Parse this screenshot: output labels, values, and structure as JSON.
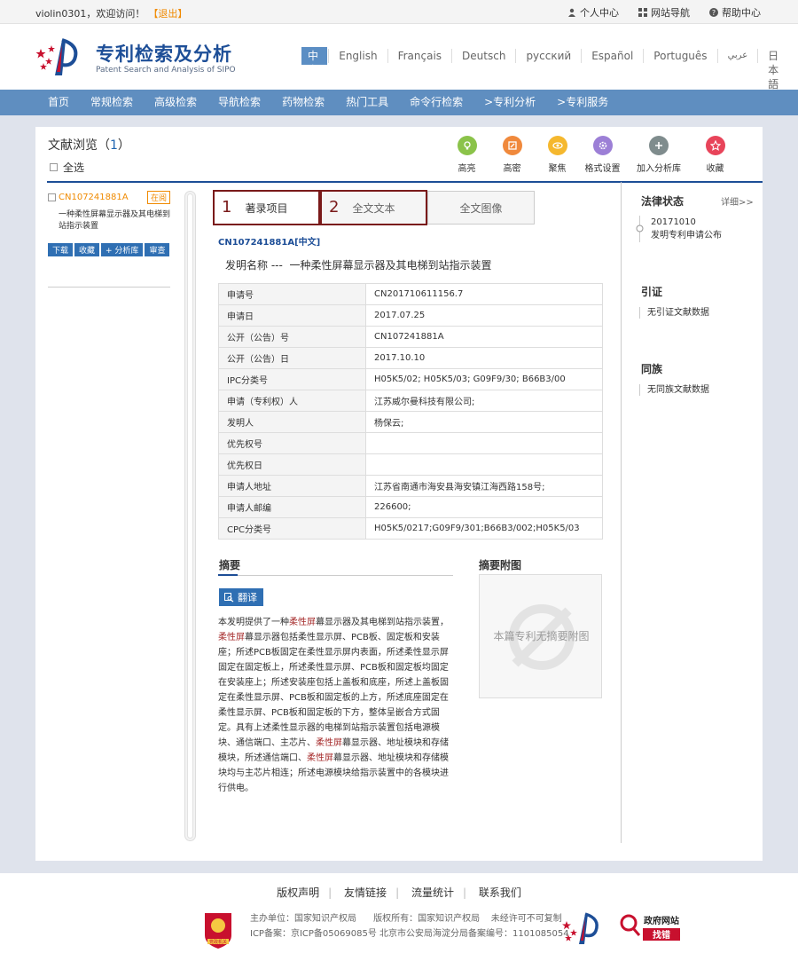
{
  "topbar": {
    "welcome": "violin0301，欢迎访问！",
    "logout": "【退出】",
    "links": [
      {
        "icon": "user-icon",
        "label": "个人中心"
      },
      {
        "icon": "grid-icon",
        "label": "网站导航"
      },
      {
        "icon": "help-icon",
        "label": "帮助中心"
      }
    ]
  },
  "header": {
    "title": "专利检索及分析",
    "subtitle": "Patent Search and Analysis of SIPO",
    "languages": [
      "中文",
      "English",
      "Français",
      "Deutsch",
      "русский",
      "Español",
      "Português",
      "عربي",
      "日本語"
    ],
    "active_language": "中文"
  },
  "nav": [
    "首页",
    "常规检索",
    "高级检索",
    "导航检索",
    "药物检索",
    "热门工具",
    "命令行检索",
    ">专利分析",
    ">专利服务"
  ],
  "browse": {
    "title": "文献浏览（",
    "count": "1",
    "title_end": "）",
    "select_all": "全选"
  },
  "tools": [
    {
      "label": "高亮",
      "icon": "highlight-icon",
      "color": "#8bc34a"
    },
    {
      "label": "高密",
      "icon": "density-icon",
      "color": "#f0893c"
    },
    {
      "label": "聚焦",
      "icon": "focus-icon",
      "color": "#f5b82e"
    },
    {
      "label": "格式设置",
      "icon": "format-icon",
      "color": "#9c7fd6"
    },
    {
      "label": "加入分析库",
      "icon": "add-icon",
      "color": "#7f8c8d"
    },
    {
      "label": "收藏",
      "icon": "star-icon",
      "color": "#e8445a"
    }
  ],
  "result": {
    "number": "CN107241881A",
    "status": "在阅",
    "desc": "一种柔性屏幕显示器及其电梯到站指示装置",
    "buttons": [
      "下载",
      "收藏",
      "+ 分析库",
      "审查"
    ]
  },
  "tabs": [
    {
      "num": "1",
      "label": "著录项目"
    },
    {
      "num": "2",
      "label": "全文文本"
    },
    {
      "num": "",
      "label": "全文图像"
    }
  ],
  "patent": {
    "link": "CN107241881A[中文]",
    "name_label": "发明名称 ---",
    "name": "一种柔性屏幕显示器及其电梯到站指示装置",
    "fields": [
      {
        "k": "申请号",
        "v": "CN201710611156.7"
      },
      {
        "k": "申请日",
        "v": "2017.07.25"
      },
      {
        "k": "公开（公告）号",
        "v": "CN107241881A"
      },
      {
        "k": "公开（公告）日",
        "v": "2017.10.10"
      },
      {
        "k": "IPC分类号",
        "v": "H05K5/02; H05K5/03; G09F9/30; B66B3/00"
      },
      {
        "k": "申请（专利权）人",
        "v": "江苏威尔曼科技有限公司;"
      },
      {
        "k": "发明人",
        "v": "杨保云;"
      },
      {
        "k": "优先权号",
        "v": ""
      },
      {
        "k": "优先权日",
        "v": ""
      },
      {
        "k": "申请人地址",
        "v": "江苏省南通市海安县海安镇江海西路158号;"
      },
      {
        "k": "申请人邮编",
        "v": "226600;"
      },
      {
        "k": "CPC分类号",
        "v": "H05K5/0217;G09F9/301;B66B3/002;H05K5/03"
      }
    ]
  },
  "abstract": {
    "heading": "摘要",
    "translate": "翻译",
    "segments": [
      {
        "t": "本发明提供了一种",
        "kw": false
      },
      {
        "t": "柔性屏",
        "kw": true
      },
      {
        "t": "幕显示器及其电梯到站指示装置，",
        "kw": false
      },
      {
        "t": "柔性屏",
        "kw": true
      },
      {
        "t": "幕显示器包括柔性显示屏、PCB板、固定板和安装座；所述PCB板固定在柔性显示屏内表面，所述柔性显示屏固定在固定板上，所述柔性显示屏、PCB板和固定板均固定在安装座上；所述安装座包括上盖板和底座，所述上盖板固定在柔性显示屏、PCB板和固定板的上方，所述底座固定在柔性显示屏、PCB板和固定板的下方，整体呈嵌合方式固定。具有上述柔性显示器的电梯到站指示装置包括电源模块、通信端口、主芯片、",
        "kw": false
      },
      {
        "t": "柔性屏",
        "kw": true
      },
      {
        "t": "幕显示器、地址模块和存储模块，所述通信端口、",
        "kw": false
      },
      {
        "t": "柔性屏",
        "kw": true
      },
      {
        "t": "幕显示器、地址模块和存储模块均与主芯片相连；所述电源模块给指示装置中的各模块进行供电。",
        "kw": false
      }
    ]
  },
  "abstract_image": {
    "heading": "摘要附图",
    "empty": "本篇专利无摘要附图"
  },
  "sidebar": {
    "legal": {
      "heading": "法律状态",
      "more": "详细>>",
      "date": "20171010",
      "event": "发明专利申请公布"
    },
    "citation": {
      "heading": "引证",
      "empty": "无引证文献数据"
    },
    "family": {
      "heading": "同族",
      "empty": "无同族文献数据"
    }
  },
  "footer": {
    "links": [
      "版权声明",
      "友情链接",
      "流量统计",
      "联系我们"
    ],
    "host": "主办单位：国家知识产权局",
    "rights": "版权所有：国家知识产权局",
    "notice": "未经许可不可复制",
    "icp": "ICP备案：京ICP备05069085号 北京市公安局海淀分局备案编号：1101085054",
    "emblem_text": "党政机关",
    "gov_text1": "政府网站",
    "gov_text2": "找错"
  }
}
